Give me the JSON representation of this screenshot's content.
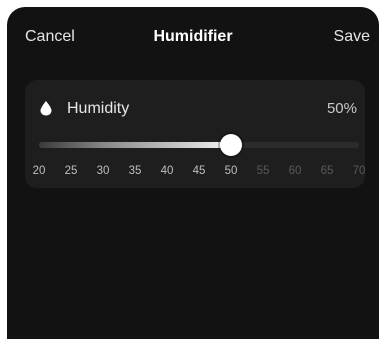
{
  "header": {
    "cancel_label": "Cancel",
    "title": "Humidifier",
    "save_label": "Save"
  },
  "humidity": {
    "icon": "water-drop-icon",
    "label": "Humidity",
    "value_text": "50%",
    "value": 50,
    "min": 20,
    "max": 70,
    "ticks": [
      "20",
      "25",
      "30",
      "35",
      "40",
      "45",
      "50",
      "55",
      "60",
      "65",
      "70"
    ]
  },
  "colors": {
    "background": "#121212",
    "card": "#1e1e1e",
    "tick_active": "#bfbfbf",
    "tick_inactive": "#5a5a5a"
  }
}
